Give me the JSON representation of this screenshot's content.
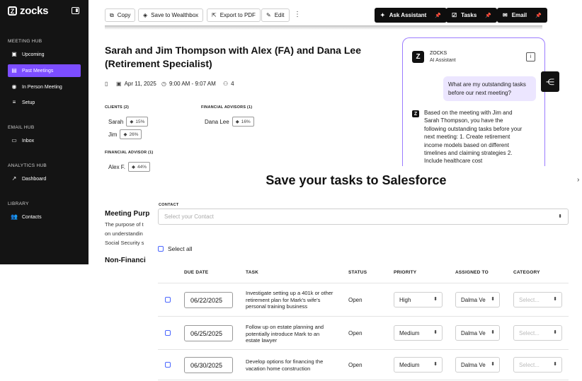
{
  "sidebar": {
    "brand": "zocks",
    "sections": {
      "meeting_hub": "MEETING HUB",
      "email_hub": "EMAIL HUB",
      "analytics_hub": "ANALYTICS HUB",
      "library": "LIBRARY"
    },
    "items": {
      "upcoming": "Upcoming",
      "past_meetings": "Past Meetings",
      "in_person": "In Person Meeting",
      "setup": "Setup",
      "inbox": "Inbox",
      "dashboard": "Dashboard",
      "contacts": "Contacts"
    },
    "active_item": "past_meetings",
    "accent_color": "#7c4dff"
  },
  "toolbar": {
    "copy": "Copy",
    "save_wealthbox": "Save to Wealthbox",
    "export_pdf": "Export to PDF",
    "edit": "Edit",
    "ask_assistant": "Ask Assistant",
    "tasks": "Tasks",
    "email": "Email"
  },
  "meeting": {
    "title": "Sarah and Jim Thompson with Alex (FA) and Dana Lee (Retirement Specialist)",
    "date": "Apr 11, 2025",
    "time": "9:00 AM - 9:07 AM",
    "attendees": "4",
    "clients_label": "CLIENTS (2)",
    "clients": [
      {
        "name": "Sarah",
        "pct": "15%"
      },
      {
        "name": "Jim",
        "pct": "26%"
      }
    ],
    "advisors_label": "FINANCIAL ADVISORS (1)",
    "advisors": [
      {
        "name": "Dana Lee",
        "pct": "16%"
      }
    ],
    "advisor_label": "FINANCIAL ADVISOR (1)",
    "advisor": [
      {
        "name": "Alex F.",
        "pct": "44%"
      }
    ],
    "purpose_heading": "Meeting Purp",
    "purpose_lines": [
      "The purpose of t",
      "on understandin",
      "Social Security s"
    ],
    "nonfin_heading": "Non-Financi"
  },
  "assistant": {
    "name": "ZOCKS",
    "subtitle": "AI Assistant",
    "info": "i",
    "user_message": "What are my outstanding tasks before our next meeting?",
    "reply": "Based on the meeting with Jim and Sarah Thompson, you have the following outstanding tasks before your next meeting: 1. Create retirement income models based on different timelines and claiming strategies 2. Include healthcare cost"
  },
  "modal": {
    "title": "Save your tasks to Salesforce",
    "contact_label": "CONTACT",
    "contact_placeholder": "Select your Contact",
    "select_all": "Select all",
    "columns": {
      "due_date": "DUE DATE",
      "task": "TASK",
      "status": "STATUS",
      "priority": "PRIORITY",
      "assigned_to": "ASSIGNED TO",
      "category": "CATEGORY"
    },
    "rows": [
      {
        "due_date": "06/22/2025",
        "task": "Investigate setting up a 401k or other retirement plan for Mark's wife's personal training business",
        "status": "Open",
        "priority": "High",
        "assigned_to": "Dalma Ve",
        "category": "Select..."
      },
      {
        "due_date": "06/25/2025",
        "task": "Follow up on estate planning and potentially introduce Mark to an estate lawyer",
        "status": "Open",
        "priority": "Medium",
        "assigned_to": "Dalma Ve",
        "category": "Select..."
      },
      {
        "due_date": "06/30/2025",
        "task": "Develop options for financing the vacation home construction",
        "status": "Open",
        "priority": "Medium",
        "assigned_to": "Dalma Ve",
        "category": "Select..."
      }
    ]
  }
}
